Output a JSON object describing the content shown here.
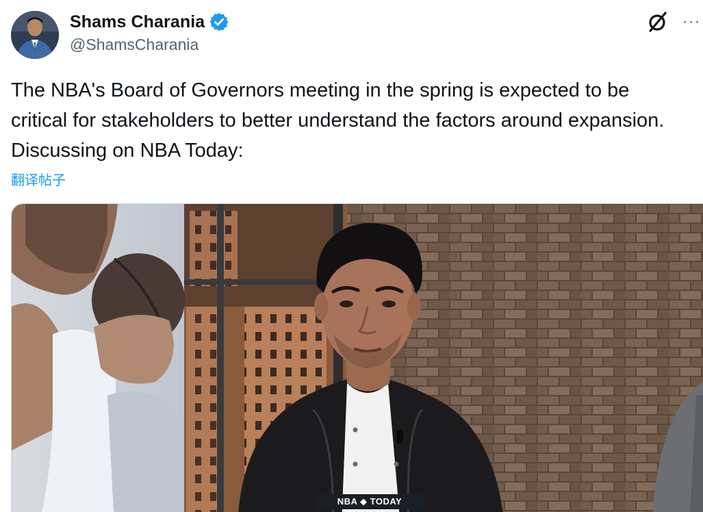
{
  "author": {
    "display_name": "Shams Charania",
    "handle": "@ShamsCharania",
    "verified": true,
    "avatar_icon": "user-avatar"
  },
  "actions": {
    "grok_icon": "grok-icon",
    "more_icon": "more-icon",
    "more_label": "···"
  },
  "tweet": {
    "text": "The NBA's Board of Governors meeting in the spring is expected to be critical for stakeholders to better understand the factors around expansion. Discussing on NBA Today:",
    "translate_label": "翻译帖子"
  },
  "media": {
    "badge_label": "NBA ◆ TODAY"
  },
  "colors": {
    "text": "#0f1419",
    "secondary": "#536471",
    "accent": "#1d9bf0"
  }
}
